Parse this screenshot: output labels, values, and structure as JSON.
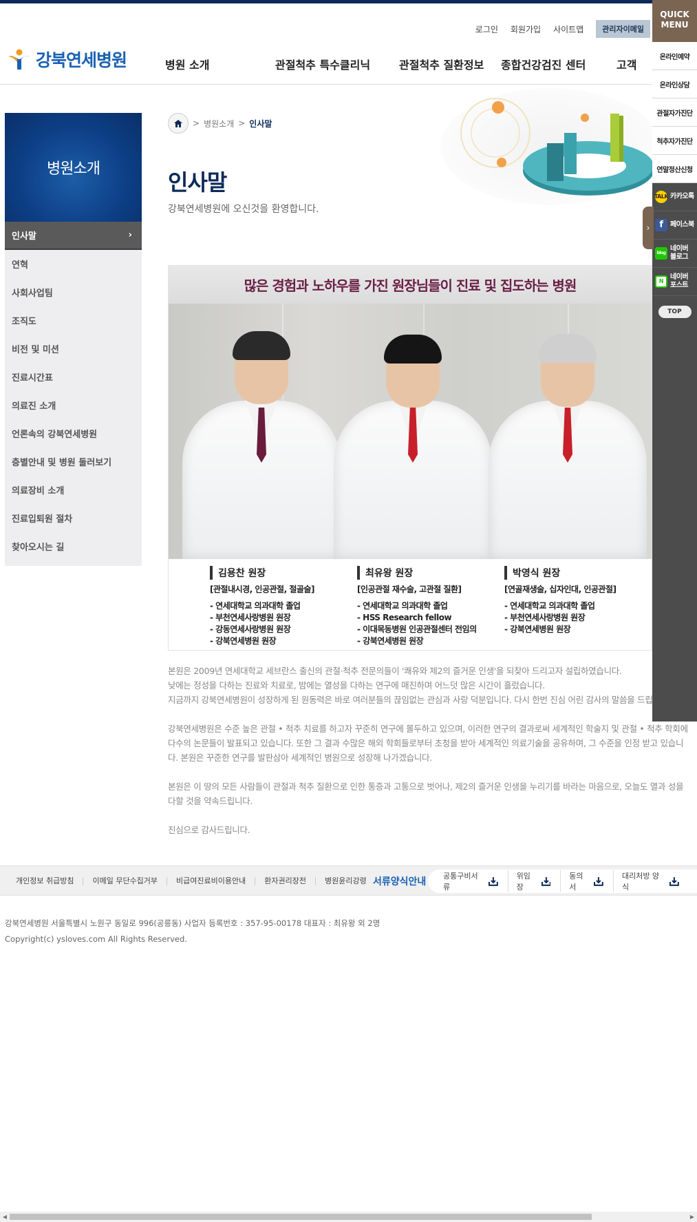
{
  "header": {
    "util_links": [
      "로그인",
      "회원가입",
      "사이트맵"
    ],
    "admin_mail": "관리자이메일",
    "logo_text": "강북연세병원",
    "gnb": [
      "병원 소개",
      "관절척추 특수클리닉",
      "관절척추 질환정보",
      "종합건강검진 센터",
      "고객"
    ]
  },
  "quick_menu": {
    "title_line1": "QUICK",
    "title_line2": "MENU",
    "items": [
      "온라인예약",
      "온라인상담",
      "관절자가진단",
      "척추자가진단",
      "연말정산신청"
    ],
    "sns": [
      {
        "label": "카카오톡",
        "icon": "TALK",
        "color": "#f7d000"
      },
      {
        "label": "페이스북",
        "icon": "f",
        "color": "#3b5998"
      },
      {
        "label1": "네이버",
        "label2": "블로그",
        "icon": "blog",
        "color": "#1ec800"
      },
      {
        "label1": "네이버",
        "label2": "포스트",
        "icon": "N",
        "color": "#1ec800"
      }
    ],
    "top": "TOP",
    "toggle": "›",
    "brand_color": "#7a6552"
  },
  "sidebar": {
    "title": "병원소개",
    "items": [
      "인사말",
      "연혁",
      "사회사업팀",
      "조직도",
      "비전 및 미션",
      "진료시간표",
      "의료진 소개",
      "언론속의 강북연세병원",
      "층별안내 및 병원 둘러보기",
      "의료장비 소개",
      "진료입퇴원 절차",
      "찾아오시는 길"
    ],
    "active_index": 0,
    "active_arrow": "›"
  },
  "breadcrumb": [
    "병원소개",
    "인사말"
  ],
  "breadcrumb_sep": ">",
  "page": {
    "title": "인사말",
    "subtitle": "강북연세병원에 오신것을 환영합니다."
  },
  "banner": {
    "headline": "많은 경험과 노하우를 가진 원장님들이 진료 및 집도하는 병원",
    "doctors": [
      {
        "name": "김용찬 원장",
        "specialty": "[관절내시경, 인공관절, 절골술]",
        "career": [
          "- 연세대학교 의과대학 졸업",
          "- 부천연세사랑병원 원장",
          "- 강동연세사랑병원 원장",
          "- 강북연세병원 원장"
        ],
        "tie": "#6a1c3c",
        "hair": "#2a2a2a"
      },
      {
        "name": "최유왕 원장",
        "specialty": "[인공관절 재수술, 고관절 질환]",
        "career": [
          "- 연세대학교 의과대학 졸업",
          "- HSS Research fellow",
          "- 이대목동병원 인공관절센터 전임의",
          "- 강북연세병원 원장"
        ],
        "tie": "#c8202a",
        "hair": "#151515"
      },
      {
        "name": "박영식 원장",
        "specialty": "[연골재생술, 십자인대, 인공관절]",
        "career": [
          "- 연세대학교 의과대학 졸업",
          "- 부천연세사랑병원 원장",
          "- 강북연세병원 원장"
        ],
        "tie": "#c8202a",
        "hair": "#cfcfcf"
      }
    ]
  },
  "intro": [
    [
      "본원은 2009년 연세대학교 세브란스 출신의 관절·척추 전문의들이 '쾌유와 제2의 즐거운 인생'을 되찾아 드리고자 설립하였습니다.",
      "낮에는 정성을 다하는 진료와 치료로, 밤에는 열성을 다하는 연구에 매진하며 어느덧 많은 시간이 흘렀습니다.",
      "지금까지 강북연세병원이 성장하게 된 원동력은 바로 여러분들의 끊임없는 관심과 사랑 덕분입니다. 다시 한번 진심 어린 감사의 말씀을 드립"
    ],
    [
      "강북연세병원은 수준 높은 관절 • 척추 치료를 하고자 꾸준히 연구에 몰두하고 있으며, 이러한 연구의 결과로써 세계적인 학술지 및 관절 • 척추 학회에",
      "다수의 논문들이 발표되고 있습니다. 또한 그 결과 수많은 해외 학회들로부터 초청을 받아 세계적인 의료기술을 공유하며, 그 수준을 인정 받고 있습니",
      "다. 본원은 꾸준한 연구를 발판삼아 세계적인 병원으로 성장해 나가겠습니다."
    ],
    [
      "본원은 이 땅의 모든 사람들이 관절과 척추 질환으로 인한 통증과 고통으로 벗어나, 제2의 즐거운 인생을 누리기를 바라는 마음으로, 오늘도 열과 성을",
      "다할 것을 약속드립니다."
    ],
    [
      "진심으로 감사드립니다."
    ]
  ],
  "footer": {
    "links": [
      "개인정보 취급방침",
      "이메일 무단수집거부",
      "비급여진료비이용안내",
      "환자권리장전",
      "병원윤리강령"
    ],
    "docs_title": "서류양식안내",
    "docs": [
      "공통구비서류",
      "위임장",
      "동의서",
      "대리처방 양식"
    ],
    "company": "강북연세병원 서울특별시 노원구 동일로 996(공릉동) 사업자 등록번호 : 357-95-00178 대표자 : 최유왕 외 2명",
    "copyright": "Copyright(c) ysloves.com All Rights Reserved."
  },
  "colors": {
    "navy": "#0b2a57",
    "brand_blue": "#1a61b3",
    "logo_orange": "#f29a1f",
    "headline": "#6a1f45"
  }
}
